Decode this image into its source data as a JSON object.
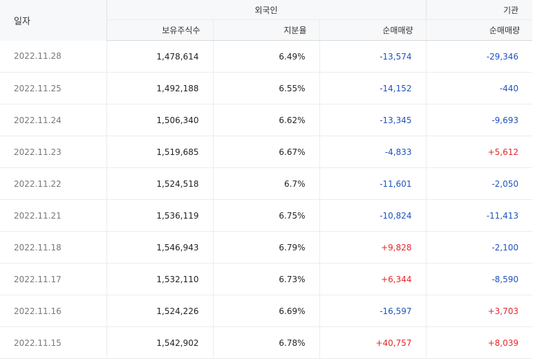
{
  "header": {
    "date_label": "일자",
    "foreign_label": "외국인",
    "institution_label": "기관",
    "holdings_label": "보유주식수",
    "share_ratio_label": "지분율",
    "foreign_net_label": "순매매량",
    "institution_net_label": "순매매량"
  },
  "colors": {
    "negative": "#1d52bd",
    "positive": "#e5262b"
  },
  "rows": [
    {
      "date": "2022.11.28",
      "holdings": "1,478,614",
      "ratio": "6.49%",
      "foreign_net": "-13,574",
      "institution_net": "-29,346"
    },
    {
      "date": "2022.11.25",
      "holdings": "1,492,188",
      "ratio": "6.55%",
      "foreign_net": "-14,152",
      "institution_net": "-440"
    },
    {
      "date": "2022.11.24",
      "holdings": "1,506,340",
      "ratio": "6.62%",
      "foreign_net": "-13,345",
      "institution_net": "-9,693"
    },
    {
      "date": "2022.11.23",
      "holdings": "1,519,685",
      "ratio": "6.67%",
      "foreign_net": "-4,833",
      "institution_net": "+5,612"
    },
    {
      "date": "2022.11.22",
      "holdings": "1,524,518",
      "ratio": "6.7%",
      "foreign_net": "-11,601",
      "institution_net": "-2,050"
    },
    {
      "date": "2022.11.21",
      "holdings": "1,536,119",
      "ratio": "6.75%",
      "foreign_net": "-10,824",
      "institution_net": "-11,413"
    },
    {
      "date": "2022.11.18",
      "holdings": "1,546,943",
      "ratio": "6.79%",
      "foreign_net": "+9,828",
      "institution_net": "-2,100"
    },
    {
      "date": "2022.11.17",
      "holdings": "1,532,110",
      "ratio": "6.73%",
      "foreign_net": "+6,344",
      "institution_net": "-8,590"
    },
    {
      "date": "2022.11.16",
      "holdings": "1,524,226",
      "ratio": "6.69%",
      "foreign_net": "-16,597",
      "institution_net": "+3,703"
    },
    {
      "date": "2022.11.15",
      "holdings": "1,542,902",
      "ratio": "6.78%",
      "foreign_net": "+40,757",
      "institution_net": "+8,039"
    }
  ]
}
